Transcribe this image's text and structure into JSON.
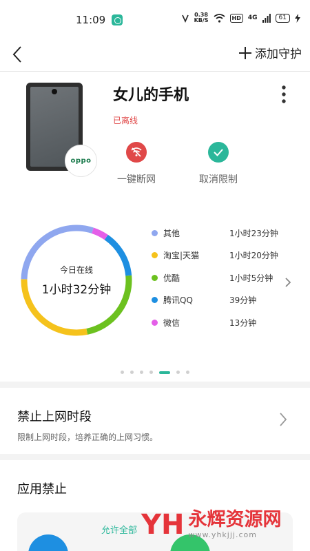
{
  "status_bar": {
    "time": "11:09",
    "speed_value": "0.38",
    "speed_unit": "KB/S",
    "hd": "HD",
    "network": "4G",
    "battery": "61"
  },
  "header": {
    "add_label": "添加守护"
  },
  "device": {
    "name": "女儿的手机",
    "status": "已离线",
    "brand": "oppo",
    "actions": [
      {
        "label": "一键断网",
        "color": "#e04848"
      },
      {
        "label": "取消限制",
        "color": "#2bb79a"
      }
    ]
  },
  "usage": {
    "center_label": "今日在线",
    "center_value": "1小时32分钟",
    "page_count": 7,
    "active_page": 5
  },
  "chart_data": {
    "type": "pie",
    "categories": [
      "其他",
      "淘宝|天猫",
      "优酷",
      "腾讯QQ",
      "微信"
    ],
    "values": [
      "1小时23分钟",
      "1小时20分钟",
      "1小时5分钟",
      "39分钟",
      "13分钟"
    ],
    "minutes": [
      83,
      80,
      65,
      39,
      13
    ],
    "colors": [
      "#8fa7ef",
      "#f5c21c",
      "#6cc11f",
      "#1e8fe1",
      "#e45fe8"
    ]
  },
  "block_time": {
    "title": "禁止上网时段",
    "description": "限制上网时段，培养正确的上网习惯。"
  },
  "app_block": {
    "title": "应用禁止",
    "allow_all": "允许全部"
  },
  "watermark": {
    "logo": "YH",
    "text": "永辉资源网",
    "url": "www.yhkjjj.com"
  }
}
